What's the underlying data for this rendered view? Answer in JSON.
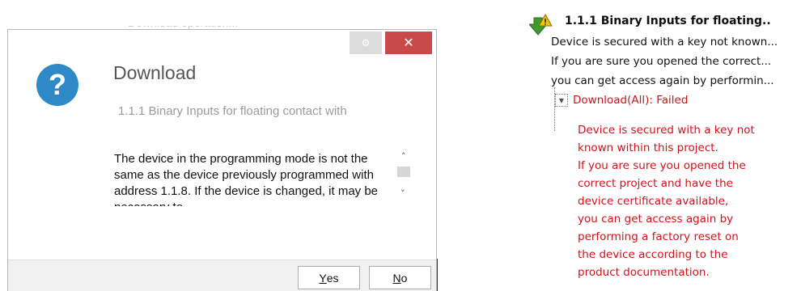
{
  "background": {
    "partial_text": "Download operation..."
  },
  "dialog": {
    "title": "Download",
    "subtitle": "1.1.1 Binary Inputs for floating contact with",
    "message": "The device in the programming mode is not the same as the device previously programmed with address 1.1.8. If the device is changed, it may be necessary to...",
    "buttons": {
      "yes": {
        "accel": "Y",
        "rest": "es"
      },
      "no": {
        "accel": "N",
        "rest": "o"
      }
    },
    "icon": "question-icon",
    "controls": {
      "close_glyph": "✕",
      "gear_glyph": "⚙"
    },
    "colors": {
      "close": "#c9484a",
      "icon": "#2e8ac7"
    }
  },
  "log": {
    "title": "1.1.1 Binary Inputs for floating..",
    "lines": [
      "Device is secured with a key not known...",
      "If you are sure you opened the correct...",
      "you can get access again by performin..."
    ],
    "expander_glyph": "▼",
    "status": "Download(All): Failed",
    "detail_lines": [
      "Device is secured with a key not",
      "known within this project.",
      "If you are sure you opened the",
      "correct project and have the",
      "device certificate available,",
      "you can get access again by",
      "performing a factory reset on",
      "the device according to the",
      "product documentation."
    ],
    "colors": {
      "error": "#d0131b"
    }
  }
}
